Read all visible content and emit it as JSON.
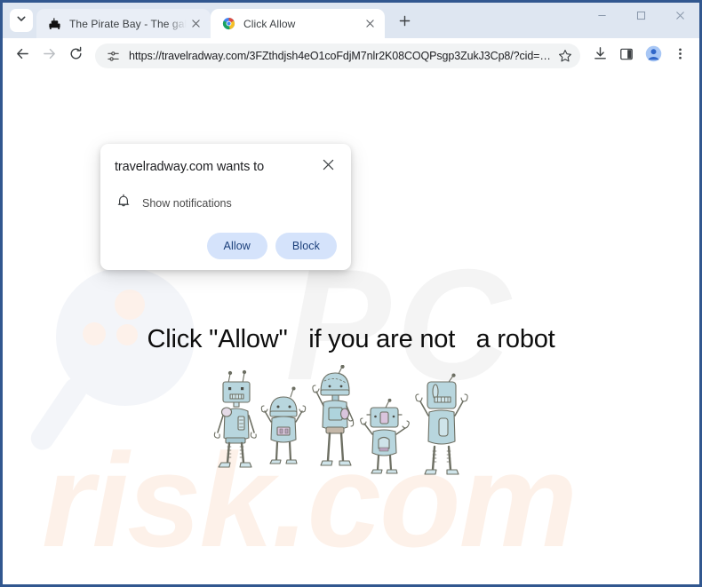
{
  "window": {
    "controls": {
      "minimize": "minimize",
      "maximize": "maximize",
      "close": "close"
    }
  },
  "tabstrip": {
    "tab_search_label": "Search tabs",
    "new_tab_label": "New Tab",
    "tabs": [
      {
        "title": "The Pirate Bay - The galaxy's m",
        "favicon": "pirate-ship-icon",
        "active": false
      },
      {
        "title": "Click Allow",
        "favicon": "chrome-globe-icon",
        "active": true
      }
    ]
  },
  "toolbar": {
    "back_label": "Back",
    "forward_label": "Forward",
    "reload_label": "Reload",
    "site_settings_label": "View site information",
    "url": "https://travelradway.com/3FZthdjsh4eO1coFdjM7nlr2K08COQPsgp3ZukJ3Cp8/?cid=…",
    "bookmark_label": "Bookmark this tab",
    "downloads_label": "Downloads",
    "side_panel_label": "Side panel",
    "profile_label": "Profile",
    "menu_label": "Customize and control Google Chrome"
  },
  "dialog": {
    "title": "travelradway.com wants to",
    "close_label": "Close",
    "permission_icon": "bell-icon",
    "permission_label": "Show notifications",
    "allow_label": "Allow",
    "block_label": "Block"
  },
  "page": {
    "headline": "Click \"Allow\"   if you are not   a robot",
    "watermark_pc": "PC",
    "watermark_risk": "risk.com",
    "robots_alt": "five cartoon robots illustration"
  },
  "colors": {
    "window_frame": "#31578f",
    "tabstrip_bg": "#dee6f1",
    "active_tab_bg": "#ffffff",
    "omnibox_bg": "#f1f3f4",
    "dialog_button_bg": "#d5e3fb",
    "dialog_button_text": "#1b3f7a",
    "profile_avatar": "#3f7de0",
    "watermark_pc": "#f4f4f4",
    "watermark_risk": "#fdf1e9",
    "robot_body": "#b8d6de"
  }
}
